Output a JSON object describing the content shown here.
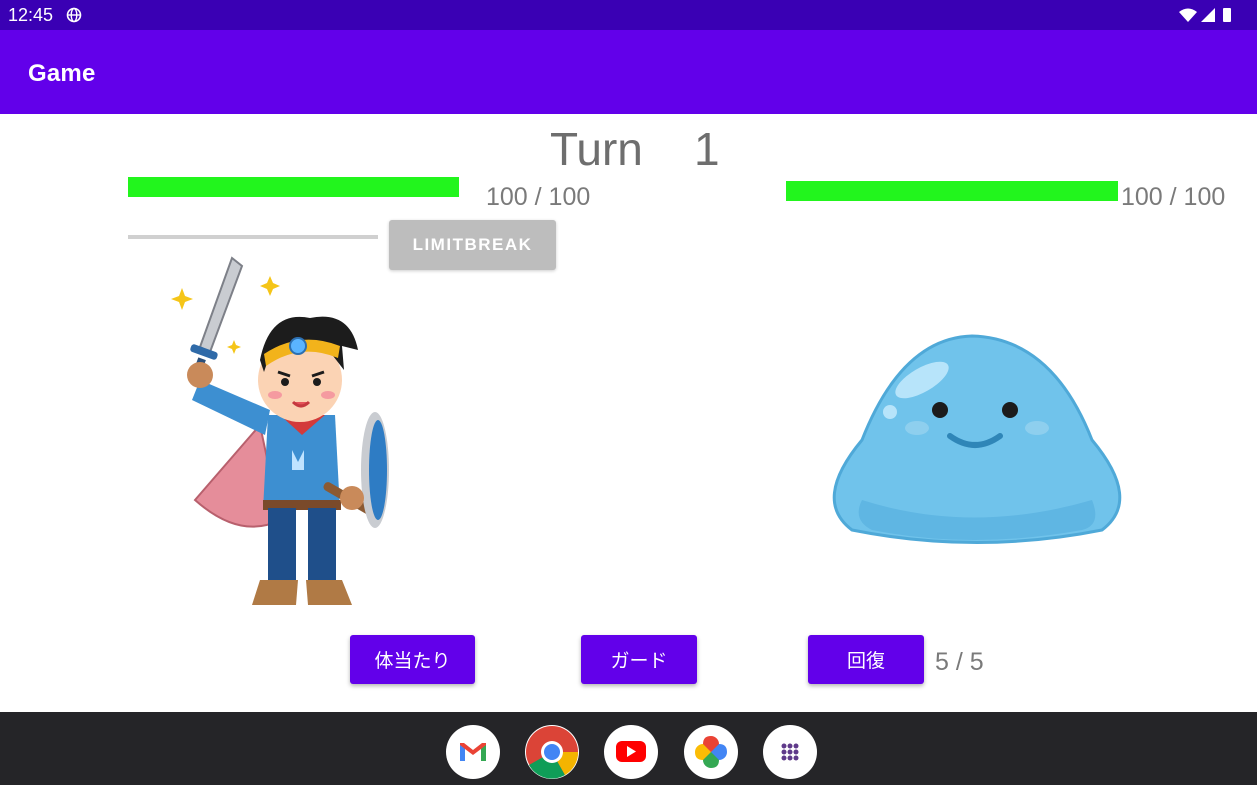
{
  "status_bar": {
    "time": "12:45"
  },
  "app_bar": {
    "title": "Game"
  },
  "battle": {
    "turn_word": "Turn",
    "turn_number": "1",
    "player": {
      "hp_text": "100 / 100",
      "hp_fraction": 1.0,
      "limit_fraction": 0.0,
      "limit_button": "LIMITBREAK"
    },
    "enemy": {
      "hp_text": "100 / 100",
      "hp_fraction": 1.0
    }
  },
  "actions": {
    "attack": "体当たり",
    "guard": "ガード",
    "heal": "回復",
    "heal_count": "5 / 5"
  },
  "dock": [
    "gmail-icon",
    "chrome-icon",
    "youtube-icon",
    "photos-icon",
    "app-drawer-icon"
  ],
  "colors": {
    "status_bar": "#3a00b4",
    "app_bar": "#6200ea",
    "hp": "#22f51d",
    "button": "#6200ea",
    "disabled": "#bdbdbd"
  }
}
